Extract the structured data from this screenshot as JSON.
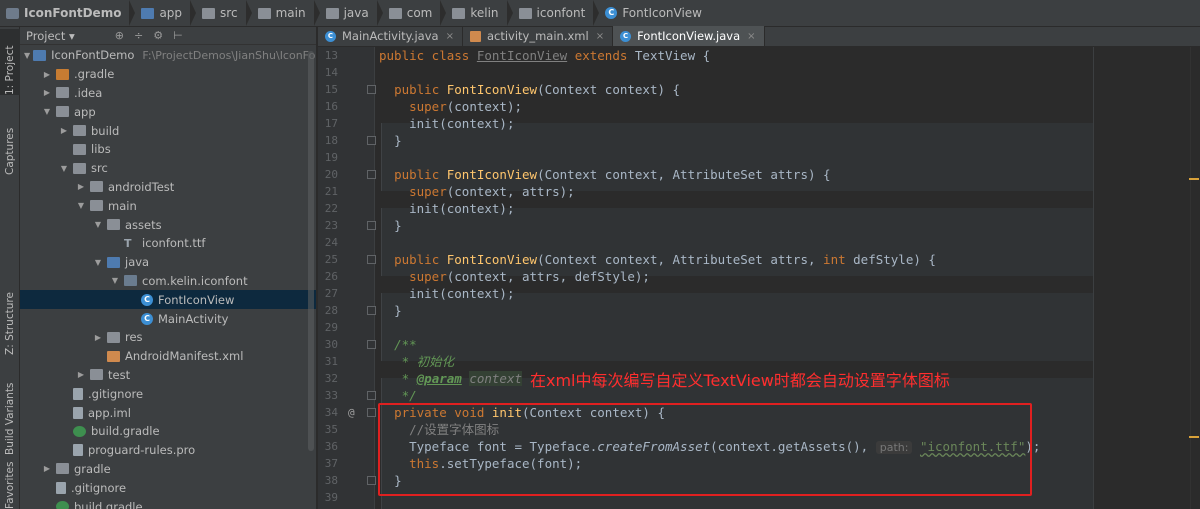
{
  "breadcrumb": [
    "IconFontDemo",
    "app",
    "src",
    "main",
    "java",
    "com",
    "kelin",
    "iconfont",
    "FontIconView"
  ],
  "left_stripe": {
    "project": "1: Project",
    "captures": "Captures",
    "structure": "Z: Structure",
    "build_variants": "Build Variants",
    "favorites": "Favorites"
  },
  "panel": {
    "view_selector": "Project",
    "tools": [
      "⊕",
      "÷",
      "⚙",
      "⊢"
    ]
  },
  "tree": [
    {
      "label": "IconFontDemo",
      "hint": "F:\\ProjectDemos\\JianShu\\IconFontDemo",
      "depth": 0,
      "arrow": "▼",
      "icon": "proj"
    },
    {
      "label": ".gradle",
      "depth": 1,
      "arrow": "▶",
      "icon": "orange"
    },
    {
      "label": ".idea",
      "depth": 1,
      "arrow": "▶",
      "icon": "folder"
    },
    {
      "label": "app",
      "depth": 1,
      "arrow": "▼",
      "icon": "folder"
    },
    {
      "label": "build",
      "depth": 2,
      "arrow": "▶",
      "icon": "folder"
    },
    {
      "label": "libs",
      "depth": 2,
      "arrow": "",
      "icon": "folder"
    },
    {
      "label": "src",
      "depth": 2,
      "arrow": "▼",
      "icon": "folder"
    },
    {
      "label": "androidTest",
      "depth": 3,
      "arrow": "▶",
      "icon": "folder"
    },
    {
      "label": "main",
      "depth": 3,
      "arrow": "▼",
      "icon": "folder"
    },
    {
      "label": "assets",
      "depth": 4,
      "arrow": "▼",
      "icon": "folder"
    },
    {
      "label": "iconfont.ttf",
      "depth": 5,
      "arrow": "",
      "icon": "text"
    },
    {
      "label": "java",
      "depth": 4,
      "arrow": "▼",
      "icon": "blue"
    },
    {
      "label": "com.kelin.iconfont",
      "depth": 5,
      "arrow": "▼",
      "icon": "pkg"
    },
    {
      "label": "FontIconView",
      "depth": 6,
      "arrow": "",
      "icon": "class",
      "selected": true
    },
    {
      "label": "MainActivity",
      "depth": 6,
      "arrow": "",
      "icon": "class"
    },
    {
      "label": "res",
      "depth": 4,
      "arrow": "▶",
      "icon": "folder"
    },
    {
      "label": "AndroidManifest.xml",
      "depth": 4,
      "arrow": "",
      "icon": "xml"
    },
    {
      "label": "test",
      "depth": 3,
      "arrow": "▶",
      "icon": "folder"
    },
    {
      "label": ".gitignore",
      "depth": 2,
      "arrow": "",
      "icon": "file"
    },
    {
      "label": "app.iml",
      "depth": 2,
      "arrow": "",
      "icon": "file"
    },
    {
      "label": "build.gradle",
      "depth": 2,
      "arrow": "",
      "icon": "gradle"
    },
    {
      "label": "proguard-rules.pro",
      "depth": 2,
      "arrow": "",
      "icon": "file"
    },
    {
      "label": "gradle",
      "depth": 1,
      "arrow": "▶",
      "icon": "folder"
    },
    {
      "label": ".gitignore",
      "depth": 1,
      "arrow": "",
      "icon": "file"
    },
    {
      "label": "build.gradle",
      "depth": 1,
      "arrow": "",
      "icon": "gradle"
    }
  ],
  "tabs": [
    {
      "label": "MainActivity.java",
      "icon": "class",
      "active": false
    },
    {
      "label": "activity_main.xml",
      "icon": "xml",
      "active": false
    },
    {
      "label": "FontIconView.java",
      "icon": "class",
      "active": true
    }
  ],
  "line_numbers": [
    "13",
    "14",
    "15",
    "16",
    "17",
    "18",
    "19",
    "20",
    "21",
    "22",
    "23",
    "24",
    "25",
    "26",
    "27",
    "28",
    "29",
    "30",
    "31",
    "32",
    "33",
    "34",
    "35",
    "36",
    "37",
    "38",
    "39"
  ],
  "gutter_marker": "@",
  "annotation": "在xml中每次编写自定义TextView时都会自动设置字体图标",
  "code": {
    "l13": {
      "kw1": "public class",
      "cls": "FontIconView",
      "kw2": "extends",
      "rest": "TextView {"
    },
    "l15": {
      "kw": "public",
      "fn": "FontIconView",
      "rest": "(Context context) {"
    },
    "l16": {
      "kw": "super",
      "rest": "(context);"
    },
    "l17": "init(context);",
    "l18": "}",
    "l20": {
      "kw": "public",
      "fn": "FontIconView",
      "rest": "(Context context, AttributeSet attrs) {"
    },
    "l21": {
      "kw": "super",
      "rest": "(context, attrs);"
    },
    "l22": "init(context);",
    "l23": "}",
    "l25": {
      "kw": "public",
      "fn": "FontIconView",
      "rest1": "(Context context, AttributeSet attrs, ",
      "kw2": "int",
      "rest2": " defStyle) {"
    },
    "l26": {
      "kw": "super",
      "rest": "(context, attrs, defStyle);"
    },
    "l27": "init(context);",
    "l28": "}",
    "l30": "/**",
    "l31": "* 初始化",
    "l32": {
      "star": "* ",
      "tag": "@param",
      "ref": "context"
    },
    "l33": "*/",
    "l34": {
      "kw": "private void",
      "fn": "init",
      "rest": "(Context context) {"
    },
    "l35": "//设置字体图标",
    "l36": {
      "pre": "Typeface font = Typeface.",
      "it": "createFromAsset",
      "mid": "(context.getAssets(), ",
      "hint": "path:",
      "str": "\"iconfont.ttf\"",
      "end": ");"
    },
    "l37": {
      "kw": "this",
      "rest": ".setTypeface(font);"
    },
    "l38": "}"
  },
  "colors": {
    "keyword": "#cc7832",
    "function": "#ffc66d",
    "string": "#6a8759",
    "comment": "#808080",
    "highlight_box": "#e02020"
  }
}
